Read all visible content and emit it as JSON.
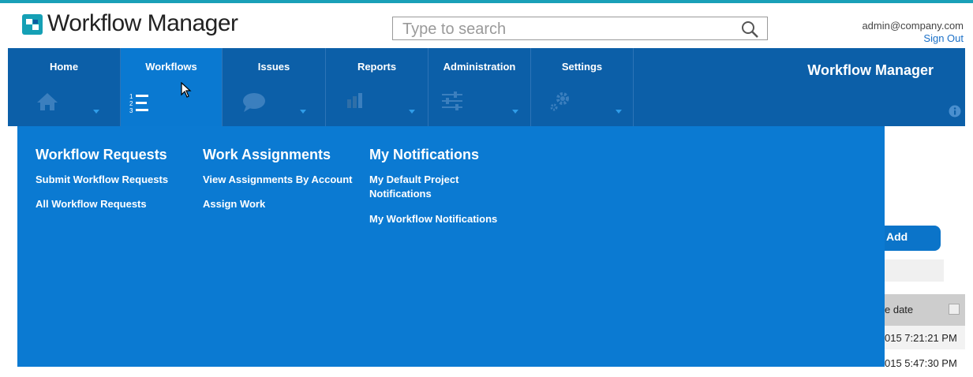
{
  "app": {
    "logo_text": "Workflow Manager"
  },
  "search": {
    "placeholder": "Type to search"
  },
  "user": {
    "email": "admin@company.com",
    "signout": "Sign Out"
  },
  "nav": {
    "tabs": [
      {
        "label": "Home",
        "icon": "home-icon"
      },
      {
        "label": "Workflows",
        "icon": "numbered-list-icon",
        "active": true
      },
      {
        "label": "Issues",
        "icon": "speech-bubble-icon"
      },
      {
        "label": "Reports",
        "icon": "bar-chart-icon"
      },
      {
        "label": "Administration",
        "icon": "sliders-icon"
      },
      {
        "label": "Settings",
        "icon": "gears-icon"
      }
    ],
    "title": "Workflow Manager"
  },
  "menu": {
    "columns": [
      {
        "heading": "Workflow Requests",
        "links": [
          "Submit Workflow Requests",
          "All Workflow Requests"
        ]
      },
      {
        "heading": "Work Assignments",
        "links": [
          "View Assignments By Account",
          "Assign Work"
        ]
      },
      {
        "heading": "My Notifications",
        "links": [
          "My Default Project Notifications",
          "My Workflow Notifications"
        ]
      }
    ]
  },
  "background": {
    "add_button": "Add",
    "column_header": "e date",
    "rows": [
      "015 7:21:21 PM",
      "015 5:47:30 PM"
    ]
  },
  "colors": {
    "nav_bg": "#0c5fa8",
    "active_tab": "#0a79d1",
    "panel_bg": "#0b7ad2",
    "accent": "#1aa0b8"
  }
}
